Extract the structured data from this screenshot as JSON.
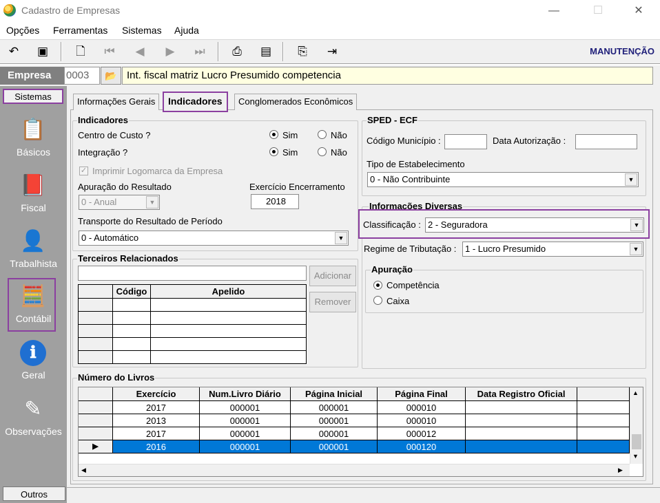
{
  "window": {
    "title": "Cadastro de Empresas",
    "min": "—",
    "max": "☐",
    "close": "✕"
  },
  "menu": [
    "Opções",
    "Ferramentas",
    "Sistemas",
    "Ajuda"
  ],
  "toolbar": {
    "mode": "MANUTENÇÃO",
    "icons": [
      "undo-icon",
      "save-icon",
      "preview-icon",
      "first-icon",
      "prev-icon",
      "next-icon",
      "last-icon",
      "print-icon",
      "report-icon",
      "export-icon",
      "exit-icon"
    ]
  },
  "empresa": {
    "label": "Empresa",
    "code": "0003",
    "folder": "📂",
    "name": "Int. fiscal  matriz Lucro Presumido competencia"
  },
  "sidebar": {
    "top": "Sistemas",
    "bottom": "Outros",
    "items": [
      {
        "label": "Básicos",
        "icon": "📋"
      },
      {
        "label": "Fiscal",
        "icon": "📕"
      },
      {
        "label": "Trabalhista",
        "icon": "👤"
      },
      {
        "label": "Contábil",
        "icon": "🧮"
      },
      {
        "label": "Geral",
        "icon": "ℹ"
      },
      {
        "label": "Observações",
        "icon": "✎"
      }
    ]
  },
  "tabs": [
    "Informações Gerais",
    "Indicadores",
    "Conglomerados Econômicos"
  ],
  "indicadores": {
    "title": "Indicadores",
    "centro_custo": "Centro de Custo ?",
    "integracao": "Integração ?",
    "sim": "Sim",
    "nao": "Não",
    "imprimir_logo": "Imprimir Logomarca da Empresa",
    "apuracao_label": "Apuração do Resultado",
    "apuracao_value": "0 - Anual",
    "exercicio_label": "Exercício Encerramento",
    "exercicio_value": "2018",
    "transporte_label": "Transporte do Resultado de Período",
    "transporte_value": "0 - Automático"
  },
  "terceiros": {
    "title": "Terceiros Relacionados",
    "col_codigo": "Código",
    "col_apelido": "Apelido",
    "adicionar": "Adicionar",
    "remover": "Remover"
  },
  "sped": {
    "title": "SPED - ECF",
    "cod_municipio": "Código Município :",
    "data_autorizacao": "Data Autorização :",
    "tipo_label": "Tipo de Estabelecimento",
    "tipo_value": "0 - Não Contribuinte"
  },
  "diversas": {
    "title": "Informações Diversas",
    "classificacao_label": "Classificação :",
    "classificacao_value": "2 - Seguradora",
    "regime_label": "Regime de Tributação :",
    "regime_value": "1 - Lucro Presumido"
  },
  "apuracao": {
    "title": "Apuração",
    "competencia": "Competência",
    "caixa": "Caixa"
  },
  "livros": {
    "title": "Número do Livros",
    "columns": [
      "Exercício",
      "Num.Livro Diário",
      "Página Inicial",
      "Página Final",
      "Data Registro Oficial"
    ],
    "rows": [
      [
        "2017",
        "000001",
        "000001",
        "000010",
        ""
      ],
      [
        "2013",
        "000001",
        "000001",
        "000010",
        ""
      ],
      [
        "2017",
        "000001",
        "000001",
        "000012",
        ""
      ],
      [
        "2016",
        "000001",
        "000001",
        "000120",
        ""
      ]
    ],
    "selected_row": 3
  }
}
